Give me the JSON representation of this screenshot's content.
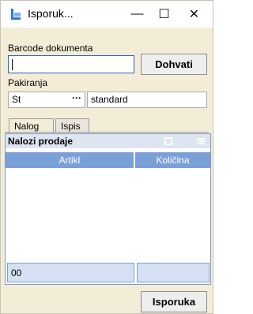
{
  "window": {
    "title": "Isporuk...",
    "minimize_glyph": "—",
    "maximize_glyph": "☐",
    "close_glyph": "✕",
    "app_icon": "delivery-app-icon"
  },
  "form": {
    "barcode_label": "Barcode dokumenta",
    "barcode_value": "",
    "fetch_button": "Dohvati",
    "packaging_label": "Pakiranja",
    "packaging_code": "St",
    "packaging_lookup_glyph": "···",
    "packaging_name": "standard"
  },
  "tabs": [
    {
      "label": "Nalog",
      "active": true
    },
    {
      "label": "Ispis",
      "active": false
    }
  ],
  "grid": {
    "title": "Nalozi prodaje",
    "columns": [
      "Artikl",
      "Količina"
    ],
    "rows": [],
    "footer": {
      "count": "00",
      "total": ""
    }
  },
  "actions": {
    "submit_button": "Isporuka"
  },
  "colors": {
    "window_bg": "#f3ecd7",
    "grid_header": "#7ba0d8",
    "accent_border": "#2a66c4"
  }
}
